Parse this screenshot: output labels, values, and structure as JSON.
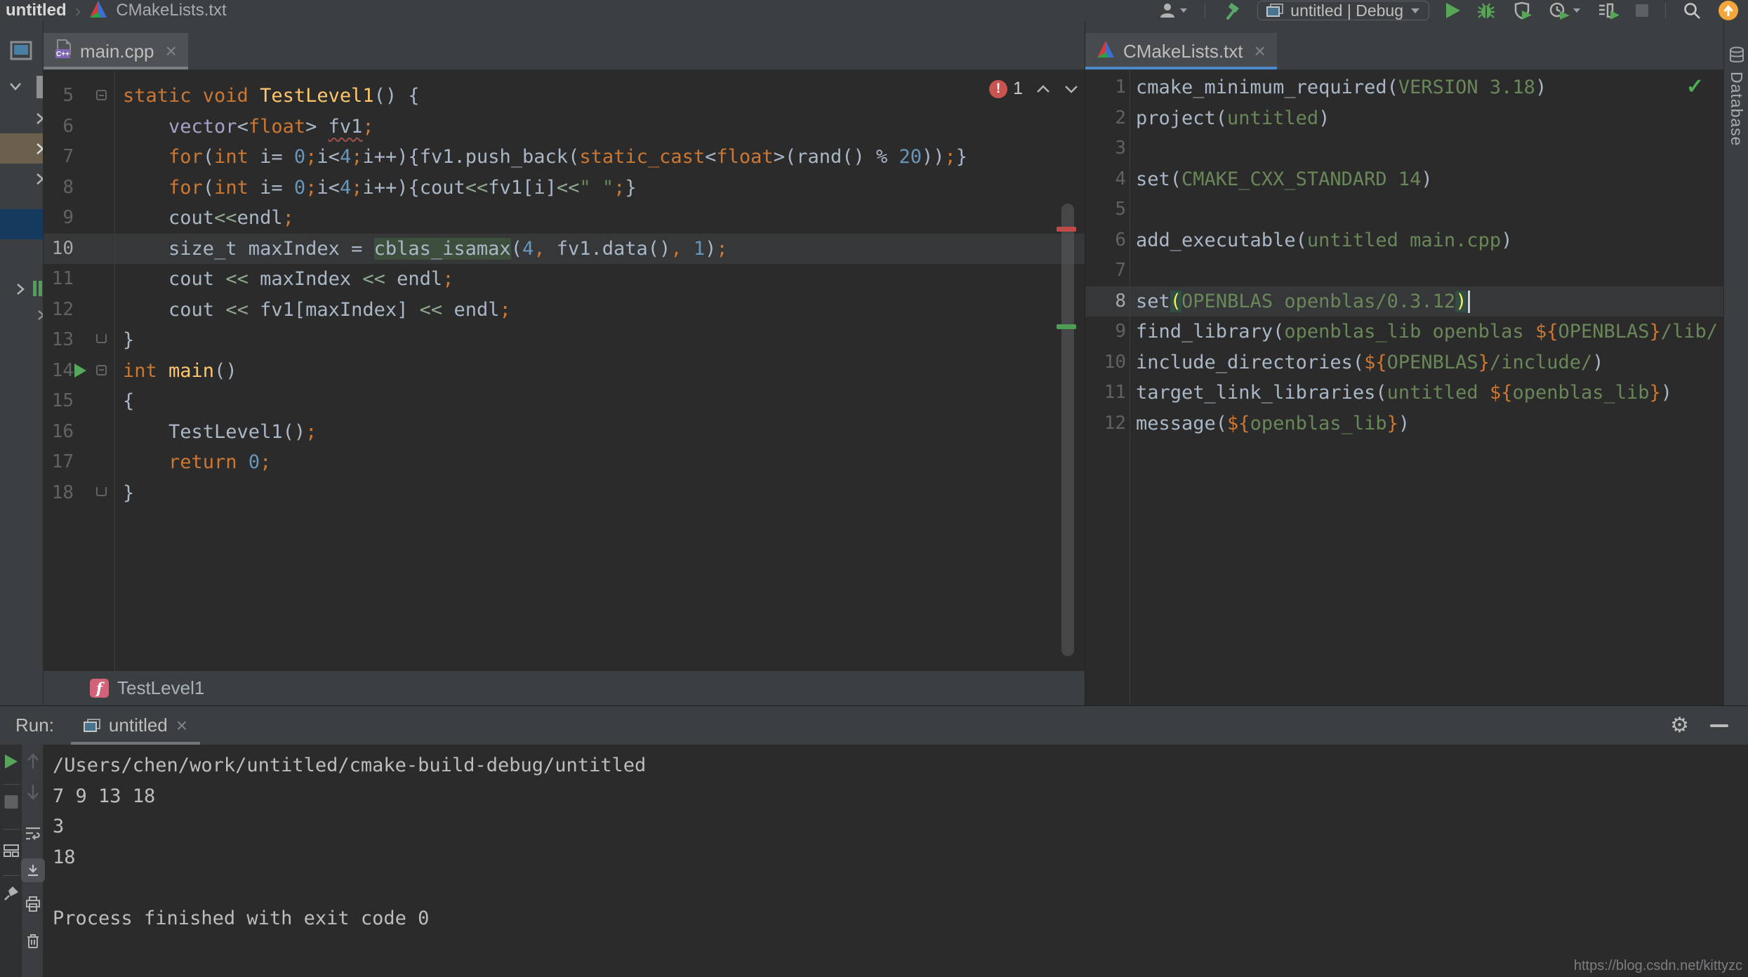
{
  "titlebar": {
    "breadcrumb": {
      "project": "untitled",
      "separator": "›",
      "file": "CMakeLists.txt"
    },
    "run_config": "untitled | Debug"
  },
  "editors": {
    "main": {
      "tab": {
        "label": "main.cpp",
        "close": "×",
        "badge": "C++"
      },
      "inspection": {
        "error_count": "1"
      },
      "breadcrumb": {
        "icon_letter": "f",
        "label": "TestLevel1"
      },
      "lines": [
        {
          "no": "5",
          "fold": "open",
          "tokens": [
            [
              "k",
              "static void "
            ],
            [
              "f",
              "TestLevel1"
            ],
            [
              "d",
              "() {"
            ]
          ]
        },
        {
          "no": "6",
          "tokens": [
            [
              "d",
              "    "
            ],
            [
              "t",
              "vector"
            ],
            [
              "d",
              "<"
            ],
            [
              "k",
              "float"
            ],
            [
              "d",
              "> "
            ],
            [
              "u",
              "fv1"
            ],
            [
              "p",
              ";"
            ]
          ]
        },
        {
          "no": "7",
          "tokens": [
            [
              "d",
              "    "
            ],
            [
              "k",
              "for"
            ],
            [
              "d",
              "("
            ],
            [
              "k",
              "int"
            ],
            [
              "d",
              " i= "
            ],
            [
              "n",
              "0"
            ],
            [
              "p",
              ";"
            ],
            [
              "d",
              "i<"
            ],
            [
              "n",
              "4"
            ],
            [
              "p",
              ";"
            ],
            [
              "d",
              "i++){fv1.push_back("
            ],
            [
              "k",
              "static_cast"
            ],
            [
              "d",
              "<"
            ],
            [
              "k",
              "float"
            ],
            [
              "d",
              ">(rand() % "
            ],
            [
              "n",
              "20"
            ],
            [
              "d",
              "))"
            ],
            [
              "p",
              ";"
            ],
            [
              "d",
              "}"
            ]
          ]
        },
        {
          "no": "8",
          "tokens": [
            [
              "d",
              "    "
            ],
            [
              "k",
              "for"
            ],
            [
              "d",
              "("
            ],
            [
              "k",
              "int"
            ],
            [
              "d",
              " i= "
            ],
            [
              "n",
              "0"
            ],
            [
              "p",
              ";"
            ],
            [
              "d",
              "i<"
            ],
            [
              "n",
              "4"
            ],
            [
              "p",
              ";"
            ],
            [
              "d",
              "i++){cout"
            ],
            [
              "o",
              "<<"
            ],
            [
              "d",
              "fv1[i]"
            ],
            [
              "o",
              "<<"
            ],
            [
              "s",
              "\" \""
            ],
            [
              "p",
              ";"
            ],
            [
              "d",
              "}"
            ]
          ]
        },
        {
          "no": "9",
          "tokens": [
            [
              "d",
              "    cout"
            ],
            [
              "o",
              "<<"
            ],
            [
              "d",
              "endl"
            ],
            [
              "p",
              ";"
            ]
          ]
        },
        {
          "no": "10",
          "current": true,
          "tokens": [
            [
              "d",
              "    size_t maxIndex = "
            ],
            [
              "hi",
              "cblas_isamax"
            ],
            [
              "d",
              "("
            ],
            [
              "n",
              "4"
            ],
            [
              "p",
              ","
            ],
            [
              "d",
              " fv1.data()"
            ],
            [
              "p",
              ","
            ],
            [
              "d",
              " "
            ],
            [
              "n",
              "1"
            ],
            [
              "d",
              ")"
            ],
            [
              "p",
              ";"
            ]
          ]
        },
        {
          "no": "11",
          "tokens": [
            [
              "d",
              "    cout "
            ],
            [
              "o",
              "<<"
            ],
            [
              "d",
              " maxIndex "
            ],
            [
              "o",
              "<<"
            ],
            [
              "d",
              " endl"
            ],
            [
              "p",
              ";"
            ]
          ]
        },
        {
          "no": "12",
          "tokens": [
            [
              "d",
              "    cout "
            ],
            [
              "o",
              "<<"
            ],
            [
              "d",
              " fv1[maxIndex] "
            ],
            [
              "o",
              "<<"
            ],
            [
              "d",
              " endl"
            ],
            [
              "p",
              ";"
            ]
          ]
        },
        {
          "no": "13",
          "fold": "end",
          "tokens": [
            [
              "d",
              "}"
            ]
          ]
        },
        {
          "no": "14",
          "fold": "open",
          "run": true,
          "tokens": [
            [
              "k",
              "int "
            ],
            [
              "f",
              "main"
            ],
            [
              "d",
              "()"
            ]
          ]
        },
        {
          "no": "15",
          "tokens": [
            [
              "d",
              "{"
            ]
          ]
        },
        {
          "no": "16",
          "tokens": [
            [
              "d",
              "    TestLevel1()"
            ],
            [
              "p",
              ";"
            ]
          ]
        },
        {
          "no": "17",
          "tokens": [
            [
              "d",
              "    "
            ],
            [
              "k",
              "return"
            ],
            [
              "d",
              " "
            ],
            [
              "n",
              "0"
            ],
            [
              "p",
              ";"
            ]
          ]
        },
        {
          "no": "18",
          "fold": "end",
          "tokens": [
            [
              "d",
              "}"
            ]
          ]
        }
      ]
    },
    "cmake": {
      "tab": {
        "label": "CMakeLists.txt",
        "close": "×"
      },
      "status_check": "✓",
      "lines": [
        {
          "no": "1",
          "tokens": [
            [
              "d",
              "cmake_minimum_required("
            ],
            [
              "a",
              "VERSION 3.18"
            ],
            [
              "d",
              ")"
            ]
          ]
        },
        {
          "no": "2",
          "tokens": [
            [
              "d",
              "project("
            ],
            [
              "a",
              "untitled"
            ],
            [
              "d",
              ")"
            ]
          ]
        },
        {
          "no": "3",
          "tokens": []
        },
        {
          "no": "4",
          "tokens": [
            [
              "d",
              "set("
            ],
            [
              "a",
              "CMAKE_CXX_STANDARD 14"
            ],
            [
              "d",
              ")"
            ]
          ]
        },
        {
          "no": "5",
          "tokens": []
        },
        {
          "no": "6",
          "tokens": [
            [
              "d",
              "add_executable("
            ],
            [
              "a",
              "untitled main.cpp"
            ],
            [
              "d",
              ")"
            ]
          ]
        },
        {
          "no": "7",
          "tokens": []
        },
        {
          "no": "8",
          "current": true,
          "caret": true,
          "tokens": [
            [
              "d",
              "set"
            ],
            [
              "pm",
              "("
            ],
            [
              "a",
              "OPENBLAS openblas/0.3.12"
            ],
            [
              "pm",
              ")"
            ]
          ]
        },
        {
          "no": "9",
          "tokens": [
            [
              "d",
              "find_library("
            ],
            [
              "a",
              "openblas_lib openblas "
            ],
            [
              "v",
              "${"
            ],
            [
              "a",
              "OPENBLAS"
            ],
            [
              "v",
              "}"
            ],
            [
              "a",
              "/lib/"
            ]
          ]
        },
        {
          "no": "10",
          "tokens": [
            [
              "d",
              "include_directories("
            ],
            [
              "v",
              "${"
            ],
            [
              "a",
              "OPENBLAS"
            ],
            [
              "v",
              "}"
            ],
            [
              "a",
              "/include/"
            ],
            [
              "d",
              ")"
            ]
          ]
        },
        {
          "no": "11",
          "tokens": [
            [
              "d",
              "target_link_libraries("
            ],
            [
              "a",
              "untitled "
            ],
            [
              "v",
              "${"
            ],
            [
              "a",
              "openblas_lib"
            ],
            [
              "v",
              "}"
            ],
            [
              "d",
              ")"
            ]
          ]
        },
        {
          "no": "12",
          "tokens": [
            [
              "d",
              "message("
            ],
            [
              "v",
              "${"
            ],
            [
              "a",
              "openblas_lib"
            ],
            [
              "v",
              "}"
            ],
            [
              "d",
              ")"
            ]
          ]
        }
      ]
    }
  },
  "run_panel": {
    "label": "Run:",
    "tab": {
      "label": "untitled",
      "close": "×"
    },
    "console_lines": [
      "/Users/chen/work/untitled/cmake-build-debug/untitled",
      "7 9 13 18",
      "3",
      "18",
      "",
      "Process finished with exit code 0"
    ]
  },
  "right_strip": {
    "label": "Database"
  },
  "watermark": "https://blog.csdn.net/kittyzc",
  "colors": {
    "accent_blue": "#4A88C8",
    "run_green": "#57A557",
    "error_red": "#C75450",
    "warning_orange": "#F2A63B",
    "editor_bg": "#2B2B2B",
    "panel_bg": "#3C3F41"
  }
}
